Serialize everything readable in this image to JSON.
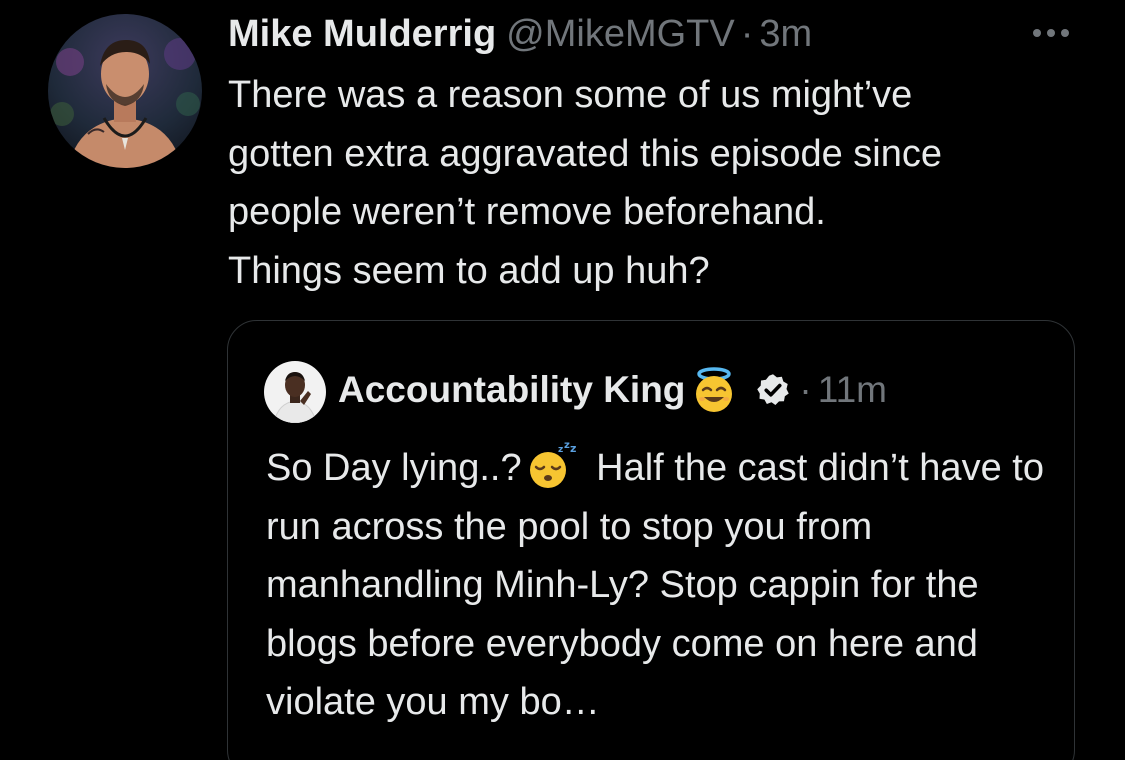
{
  "tweet": {
    "author": {
      "display_name": "Mike Mulderrig",
      "handle": "@MikeMGTV",
      "separator": "·",
      "time": "3m"
    },
    "more_icon": "ellipsis-icon",
    "text": "There was a reason some of us might’ve\ngotten extra aggravated this episode since\npeople weren’t remove beforehand.\nThings seem to add up huh?"
  },
  "quoted_tweet": {
    "author": {
      "display_name": "Accountability King",
      "name_emoji": "smiling-face-with-halo",
      "verified_icon": "verified-badge-icon",
      "separator": "·",
      "time": "11m"
    },
    "text_part1": "So Day lying..?",
    "emoji": "sleeping-face",
    "text_part2": " Half the cast didn’t have to run across the pool to stop you from manhandling Minh-Ly? Stop cappin for the blogs before everybody come on here and violate you my bo…"
  },
  "colors": {
    "background": "#000000",
    "primary_text": "#e7e9ea",
    "secondary_text": "#71767b",
    "border": "#2f3336"
  }
}
